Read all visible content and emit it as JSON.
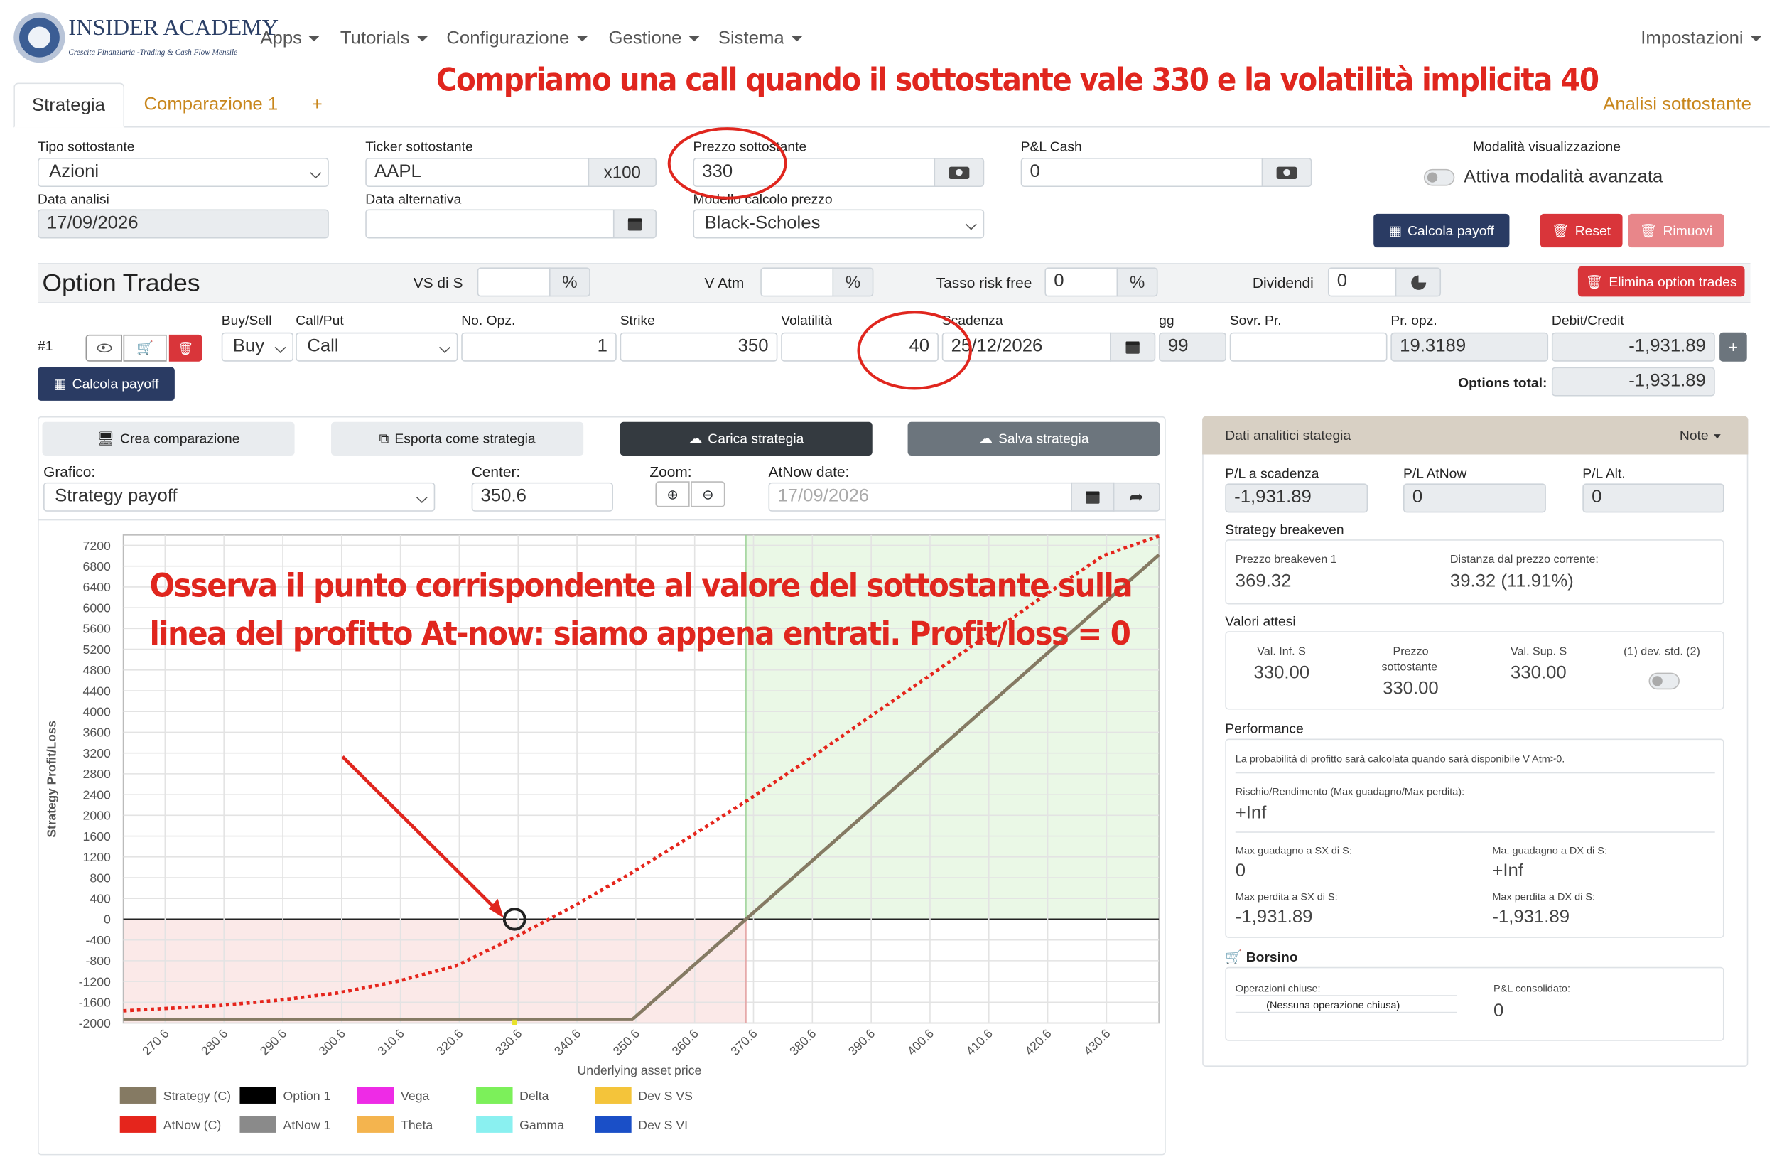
{
  "brand": {
    "name": "INSIDER ACADEMY",
    "tagline": "Crescita Finanziaria -Trading & Cash Flow Mensile"
  },
  "nav": {
    "items": [
      "Apps",
      "Tutorials",
      "Configurazione",
      "Gestione",
      "Sistema"
    ],
    "right": "Impostazioni"
  },
  "annotations": {
    "top": "Compriamo una call quando il sottostante vale 330 e la volatilità implicita 40",
    "chart_line1": "Osserva il punto corrispondente al valore del sottostante sulla",
    "chart_line2": "linea del profitto At-now: siamo appena entrati. Profit/loss = 0"
  },
  "tabs": {
    "strategia": "Strategia",
    "comparazione": "Comparazione 1",
    "add": "+",
    "analisi": "Analisi sottostante"
  },
  "form": {
    "tipo_label": "Tipo sottostante",
    "tipo_value": "Azioni",
    "ticker_label": "Ticker sottostante",
    "ticker_value": "AAPL",
    "ticker_mult": "x100",
    "prezzo_label": "Prezzo sottostante",
    "prezzo_value": "330",
    "pl_cash_label": "P&L Cash",
    "pl_cash_value": "0",
    "modalita_label": "Modalità visualizzazione",
    "modalita_toggle": "Attiva modalità avanzata",
    "data_label": "Data analisi",
    "data_value": "17/09/2026",
    "data_alt_label": "Data alternativa",
    "data_alt_value": "",
    "modello_label": "Modello calcolo prezzo",
    "modello_value": "Black-Scholes"
  },
  "buttons": {
    "calcola": "Calcola payoff",
    "reset": "Reset",
    "rimuovi": "Rimuovi",
    "elimina": "Elimina option trades",
    "calcola2": "Calcola payoff",
    "crea": "Crea comparazione",
    "esporta": "Esporta come strategia",
    "carica": "Carica strategia",
    "salva": "Salva strategia"
  },
  "option_trades": {
    "title": "Option Trades",
    "vs_label": "VS di S",
    "vatm_label": "V Atm",
    "tasso_label": "Tasso risk free",
    "tasso_value": "0",
    "dividendi_label": "Dividendi",
    "dividendi_value": "0",
    "headers": {
      "buysell": "Buy/Sell",
      "callput": "Call/Put",
      "nopz": "No. Opz.",
      "strike": "Strike",
      "vol": "Volatilità",
      "scadenza": "Scadenza",
      "gg": "gg",
      "sovr": "Sovr. Pr.",
      "propz": "Pr. opz.",
      "debit": "Debit/Credit"
    },
    "row": {
      "num": "#1",
      "buysell": "Buy",
      "callput": "Call",
      "nopz": "1",
      "strike": "350",
      "vol": "40",
      "scadenza": "25/12/2026",
      "gg": "99",
      "sovr": "",
      "propz": "19.3189",
      "debit": "-1,931.89"
    },
    "total_label": "Options total:",
    "total_value": "-1,931.89",
    "add": "+"
  },
  "chart_controls": {
    "grafico_label": "Grafico:",
    "grafico_value": "Strategy payoff",
    "center_label": "Center:",
    "center_value": "350.6",
    "zoom_label": "Zoom:",
    "atnow_label": "AtNow date:",
    "atnow_value": "17/09/2026"
  },
  "chart_data": {
    "type": "line",
    "xlabel": "Underlying asset price",
    "ylabel": "Strategy Profit/Loss",
    "x_ticks": [
      "270.6",
      "280.6",
      "290.6",
      "300.6",
      "310.6",
      "320.6",
      "330.6",
      "340.6",
      "350.6",
      "360.6",
      "370.6",
      "380.6",
      "390.6",
      "400.6",
      "410.6",
      "420.6",
      "430.6"
    ],
    "y_ticks": [
      "7200",
      "6800",
      "6400",
      "6000",
      "5600",
      "5200",
      "4800",
      "4400",
      "4000",
      "3600",
      "3200",
      "2800",
      "2400",
      "2000",
      "1600",
      "1200",
      "800",
      "400",
      "0",
      "-400",
      "-800",
      "-1200",
      "-1600",
      "-2000"
    ],
    "xlim": [
      263.5,
      439.5
    ],
    "ylim": [
      -2000,
      7400
    ],
    "breakeven": 369.32,
    "marker": {
      "x": 330,
      "y": 0
    },
    "strike": 350,
    "premium": -1931.89,
    "series": [
      {
        "name": "Strategy (C)",
        "color": "#857a63",
        "points": [
          [
            263.5,
            -1931.89
          ],
          [
            350,
            -1931.89
          ],
          [
            439.5,
            7018
          ]
        ]
      },
      {
        "name": "AtNow (C)",
        "color": "#e5251c",
        "points": [
          [
            263.5,
            -1765
          ],
          [
            280,
            -1660
          ],
          [
            290,
            -1560
          ],
          [
            300,
            -1420
          ],
          [
            310,
            -1200
          ],
          [
            320,
            -900
          ],
          [
            330,
            -350
          ],
          [
            340,
            250
          ],
          [
            350,
            900
          ],
          [
            360,
            1600
          ],
          [
            370,
            2320
          ],
          [
            380,
            3080
          ],
          [
            390,
            3870
          ],
          [
            400,
            4650
          ],
          [
            410,
            5440
          ],
          [
            420,
            6230
          ],
          [
            430,
            7000
          ],
          [
            439.5,
            7380
          ]
        ]
      }
    ],
    "legend": [
      {
        "name": "Strategy (C)",
        "color": "#857a63"
      },
      {
        "name": "Option 1",
        "color": "#000000"
      },
      {
        "name": "Vega",
        "color": "#ee2be6"
      },
      {
        "name": "Delta",
        "color": "#7cf05a"
      },
      {
        "name": "Dev S VS",
        "color": "#f4c43a"
      },
      {
        "name": "AtNow (C)",
        "color": "#e5251c"
      },
      {
        "name": "AtNow 1",
        "color": "#8a8a8a"
      },
      {
        "name": "Theta",
        "color": "#f4b44e"
      },
      {
        "name": "Gamma",
        "color": "#8af0f0"
      },
      {
        "name": "Dev S VI",
        "color": "#1a4fc7"
      }
    ]
  },
  "analytics": {
    "title": "Dati analitici stategia",
    "note": "Note",
    "pl_scad_label": "P/L a scadenza",
    "pl_scad_value": "-1,931.89",
    "pl_atnow_label": "P/L AtNow",
    "pl_atnow_value": "0",
    "pl_alt_label": "P/L Alt.",
    "pl_alt_value": "0",
    "breakeven_title": "Strategy breakeven",
    "be1_label": "Prezzo breakeven 1",
    "be1_value": "369.32",
    "dist_label": "Distanza dal prezzo corrente:",
    "dist_value": "39.32 (11.91%)",
    "valori_title": "Valori attesi",
    "vinf_label": "Val. Inf. S",
    "vinf_value": "330.00",
    "prezzo_label1": "Prezzo",
    "prezzo_label2": "sottostante",
    "prezzo_value": "330.00",
    "vsup_label": "Val. Sup. S",
    "vsup_value": "330.00",
    "dev_label": "(1) dev. std. (2)",
    "perf_title": "Performance",
    "perf_note": "La probabilità di profitto sarà calcolata quando sarà disponibile V Atm>0.",
    "rr_label": "Rischio/Rendimento (Max guadagno/Max perdita):",
    "rr_value": "+Inf",
    "mg_sx_label": "Max guadagno a SX di S:",
    "mg_sx_value": "0",
    "mg_dx_label": "Ma. guadagno a DX di S:",
    "mg_dx_value": "+Inf",
    "mp_sx_label": "Max perdita a SX di S:",
    "mp_sx_value": "-1,931.89",
    "mp_dx_label": "Max perdita a DX di S:",
    "mp_dx_value": "-1,931.89",
    "borsino_title": "Borsino",
    "op_label": "Operazioni chiuse:",
    "op_value": "(Nessuna operazione chiusa)",
    "plc_label": "P&L consolidato:",
    "plc_value": "0"
  },
  "colors": {
    "primary": "#2a3b63",
    "danger": "#d9353a",
    "danger_light": "#e8868a",
    "dark": "#343a40",
    "secondary": "#6c757d",
    "accent": "#c8861c",
    "annotation": "#e0261e"
  }
}
